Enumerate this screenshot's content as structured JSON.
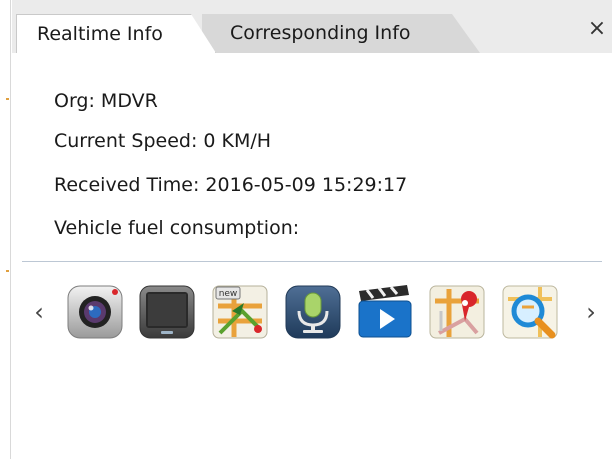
{
  "tabs": [
    {
      "label": "Realtime Info",
      "active": true
    },
    {
      "label": "Corresponding Info",
      "active": false
    }
  ],
  "close_glyph": "×",
  "info": {
    "org": "Org: MDVR",
    "speed": "Current Speed: 0 KM/H",
    "received_time": "Received Time: 2016-05-09 15:29:17",
    "fuel": "Vehicle fuel consumption:"
  },
  "toolbar": {
    "prev_glyph": "‹",
    "next_glyph": "›",
    "icons": [
      {
        "name": "camera-icon"
      },
      {
        "name": "monitor-icon"
      },
      {
        "name": "new-route-map-icon",
        "badge_text": "new"
      },
      {
        "name": "microphone-icon"
      },
      {
        "name": "video-playback-icon"
      },
      {
        "name": "map-pin-route-icon"
      },
      {
        "name": "map-search-icon"
      }
    ]
  },
  "colors": {
    "tab_strip": "#ebebeb",
    "inactive_tab": "#d8d8d8",
    "divider": "#bcc7d4",
    "text": "#1a1a1a"
  }
}
